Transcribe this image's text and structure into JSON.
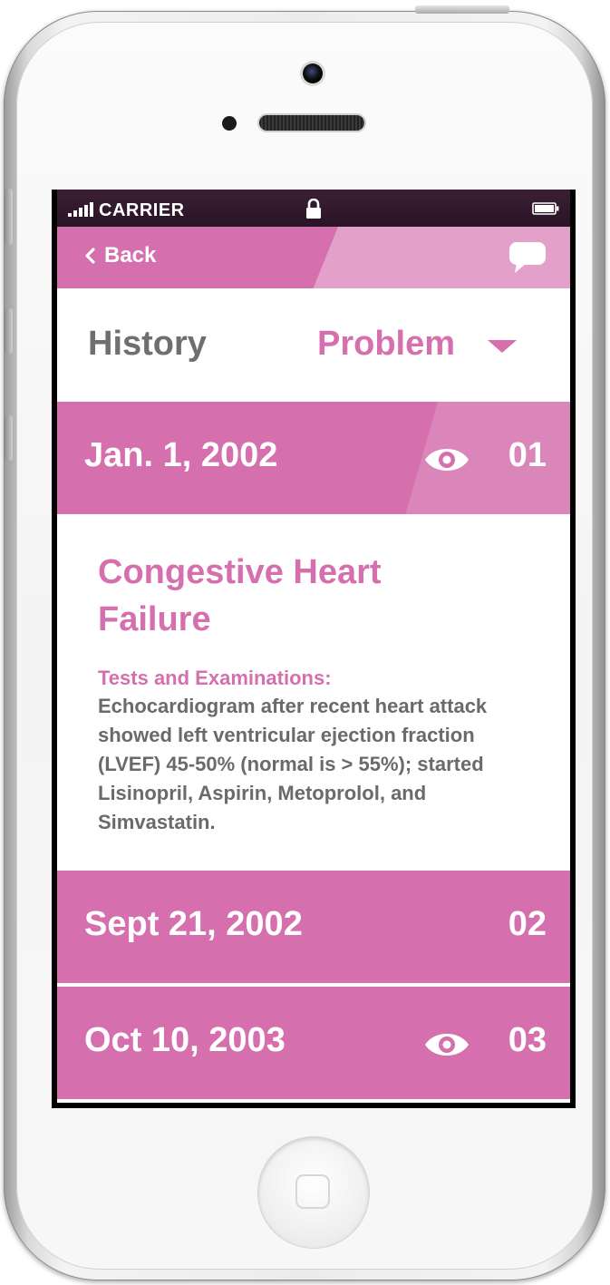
{
  "statusbar": {
    "carrier": "CARRIER",
    "signal_icon": "signal-bars-icon",
    "lock_icon": "lock-icon",
    "battery_icon": "battery-icon"
  },
  "navbar": {
    "back_label": "Back",
    "back_icon": "chevron-left-icon",
    "chat_icon": "chat-bubble-icon"
  },
  "subheader": {
    "title": "History",
    "filter_value": "Problem",
    "filter_icon": "caret-down-icon"
  },
  "entries": [
    {
      "date": "Jan. 1, 2002",
      "number": "01",
      "viewed": true,
      "expanded": true,
      "condition": "Congestive Heart Failure",
      "section_label": "Tests and Examinations:",
      "section_text": "Echocardiogram after recent heart attack showed left ventricular ejection fraction (LVEF) 45-50% (normal is > 55%); started Lisinopril, Aspirin, Metoprolol, and Simvastatin."
    },
    {
      "date": "Sept 21, 2002",
      "number": "02",
      "viewed": false,
      "expanded": false
    },
    {
      "date": "Oct 10, 2003",
      "number": "03",
      "viewed": true,
      "expanded": false
    }
  ],
  "colors": {
    "accent": "#d56fad",
    "text_gray": "#6f6f6f",
    "statusbar": "#2a1325"
  }
}
